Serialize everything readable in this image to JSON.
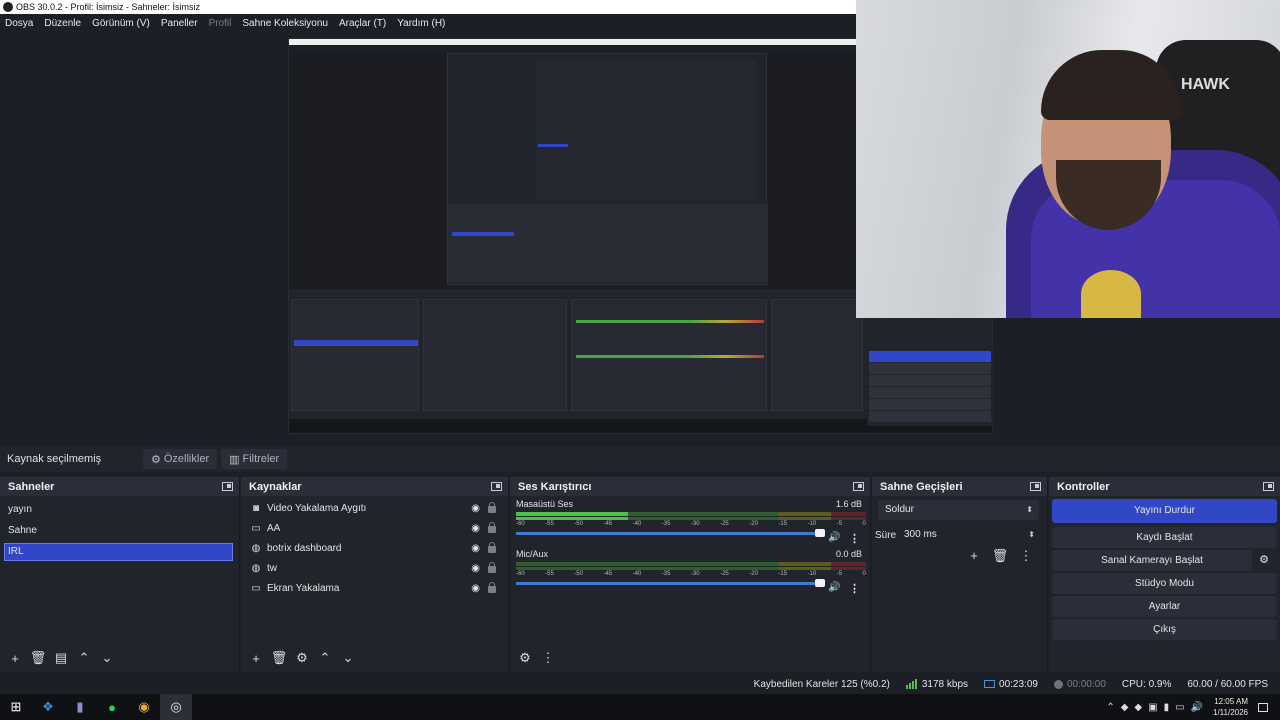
{
  "window": {
    "title": "OBS 30.0.2 - Profil: İsimsiz - Sahneler: İsimsiz"
  },
  "menu": {
    "items": [
      "Dosya",
      "Düzenle",
      "Görünüm (V)",
      "Paneller",
      "Profil",
      "Sahne Koleksiyonu",
      "Araçlar (T)",
      "Yardım (H)"
    ]
  },
  "source_toolbar": {
    "no_selection": "Kaynak seçilmemiş",
    "properties": "Özellikler",
    "filters": "Filtreler"
  },
  "scenes": {
    "title": "Sahneler",
    "items": [
      "yayın",
      "Sahne",
      "IRL"
    ],
    "selected_index": 2
  },
  "sources": {
    "title": "Kaynaklar",
    "items": [
      {
        "label": "Video Yakalama Aygıtı",
        "icon": "camera-icon"
      },
      {
        "label": "AA",
        "icon": "window-icon"
      },
      {
        "label": "botrix dashboard",
        "icon": "globe-icon"
      },
      {
        "label": "tw",
        "icon": "globe-icon"
      },
      {
        "label": "Ekran Yakalama",
        "icon": "monitor-icon"
      }
    ]
  },
  "mixer": {
    "title": "Ses Karıştırıcı",
    "channels": [
      {
        "name": "Masaüstü Ses",
        "db": "1.6 dB",
        "level": 0.32
      },
      {
        "name": "Mic/Aux",
        "db": "0.0 dB",
        "level": 0.0
      }
    ],
    "ticks": [
      "-60",
      "-55",
      "-50",
      "-45",
      "-40",
      "-35",
      "-30",
      "-25",
      "-20",
      "-15",
      "-10",
      "-5",
      "0"
    ]
  },
  "transitions": {
    "title": "Sahne Geçişleri",
    "selected": "Soldur",
    "duration_label": "Süre",
    "duration_value": "300 ms"
  },
  "controls": {
    "title": "Kontroller",
    "stop_stream": "Yayını Durdur",
    "start_recording": "Kaydı Başlat",
    "virtual_cam": "Sanal Kamerayı Başlat",
    "studio_mode": "Stüdyo Modu",
    "settings": "Ayarlar",
    "exit": "Çıkış"
  },
  "status": {
    "dropped_frames": "Kaybedilen Kareler 125 (%0.2)",
    "bitrate": "3178 kbps",
    "stream_time": "00:23:09",
    "rec_time": "00:00:00",
    "cpu": "CPU: 0.9%",
    "fps": "60.00 / 60.00 FPS"
  },
  "preview_feed": {
    "chair_brand": "HAWK"
  },
  "taskbar": {
    "time": "12:05 AM",
    "date": "1/11/2026"
  },
  "colors": {
    "accent": "#3247c7",
    "panel": "#22242b",
    "header": "#2b2e38",
    "meter_green": "#4cc14c"
  }
}
